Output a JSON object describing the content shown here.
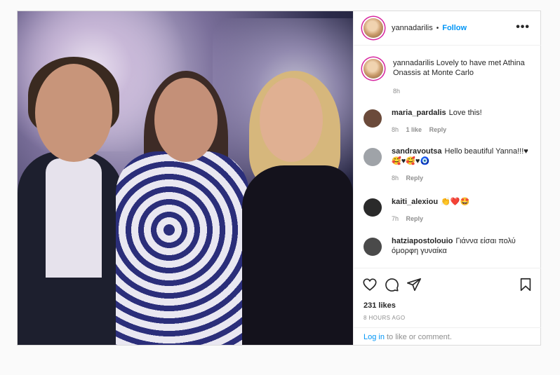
{
  "post": {
    "author": "yannadarilis",
    "dot": "•",
    "follow_label": "Follow",
    "more_label": "•••",
    "caption_author": "yannadarilis",
    "caption_text": "Lovely to have met Athina Onassis at Monte Carlo",
    "caption_time": "8h"
  },
  "comments": [
    {
      "user": "maria_pardalis",
      "text": "Love this!",
      "time": "8h",
      "likes": "1 like",
      "reply": "Reply",
      "avatar_color": "#6b4a3a"
    },
    {
      "user": "sandravoutsa",
      "text": "Hello beautiful Yanna!!!♥",
      "text2": "🥰♥🥰♥🧿",
      "time": "8h",
      "reply": "Reply",
      "avatar_color": "#9fa3a8"
    },
    {
      "user": "kaiti_alexiou",
      "text": "👏❤️🤩",
      "time": "7h",
      "reply": "Reply",
      "avatar_color": "#2a2a2a"
    },
    {
      "user": "hatziapostolouio",
      "text": "Γιάννα είσαι πολύ όμορφη γυναίκα",
      "avatar_color": "#4a4a4a"
    }
  ],
  "actions": {
    "likes": "231 likes",
    "date": "8 HOURS AGO",
    "login_link": "Log in",
    "login_text": "to like or comment."
  }
}
